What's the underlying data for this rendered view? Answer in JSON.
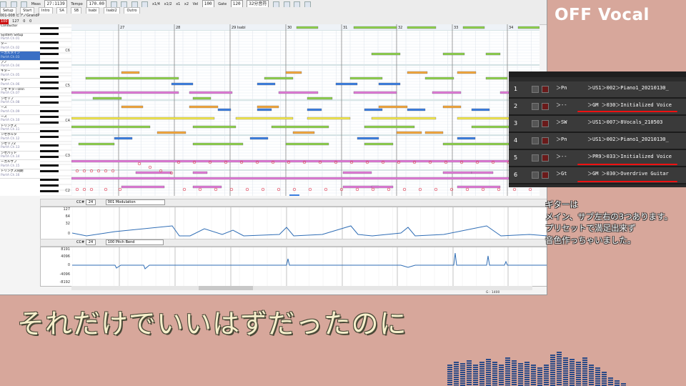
{
  "app": {
    "toolbar1": {
      "counter_label": "Meas",
      "counter_value": "27:1139",
      "tempo_label": "Tempo",
      "tempo_value": "170.00",
      "zoom_labels": [
        "x1/4",
        "x1/2",
        "x1",
        "x2"
      ],
      "vel_label": "Vel",
      "vel_value": "100",
      "gate_label": "Gate",
      "gate_value": "120",
      "snap_value": "32分音符"
    },
    "toolbar2": {
      "menu_items": [
        "Setup",
        "Start",
        "Intro",
        "SA",
        "SB",
        "Isabi",
        "Isabi2",
        "Outro"
      ]
    },
    "toolbar3": {
      "track_name": "001-008 ピアノGrandP",
      "values": [
        "100",
        "127",
        "0",
        "0"
      ]
    },
    "tracks": [
      {
        "name": "Conductor",
        "sub": ""
      },
      {
        "name": "System Setup",
        "sub": "PartA Ch.01"
      },
      {
        "name": "ター",
        "sub": "PartA Ch.02"
      },
      {
        "name": "ーカルメイン",
        "sub": "PartA Ch.03"
      },
      {
        "name": "アノ",
        "sub": "PartA Ch.04"
      },
      {
        "name": "ギター",
        "sub": "PartA Ch.05"
      },
      {
        "name": "ギター",
        "sub": "PartA Ch.06"
      },
      {
        "name": "ンセ ギターUnn",
        "sub": "PartA Ch.07"
      },
      {
        "name": "ンセリフ",
        "sub": "PartA Ch.08"
      },
      {
        "name": "ース",
        "sub": "PartA Ch.09"
      },
      {
        "name": "ース",
        "sub": "PartA Ch.10"
      },
      {
        "name": "トリングス",
        "sub": "PartA Ch.11"
      },
      {
        "name": "ンセボルタ",
        "sub": "PartA Ch.12"
      },
      {
        "name": "ンセリフ2",
        "sub": "PartA Ch.13"
      },
      {
        "name": "ンセパッド",
        "sub": "PartA Ch.14"
      },
      {
        "name": "ーカルサブ",
        "sub": "PartA Ch.15"
      },
      {
        "name": "トリングス同期",
        "sub": "PartA Ch.16"
      }
    ],
    "selected_track_index": 3,
    "measures": [
      "27",
      "28",
      "29 Isabi",
      "30",
      "31",
      "32",
      "33",
      "34"
    ],
    "octave_labels": [
      "C6",
      "C5",
      "C4",
      "C3",
      "C2"
    ],
    "controller1": {
      "cc": "CC#",
      "cc_num": "24",
      "type": "001 Modulation",
      "scale": [
        "127",
        "64",
        "32",
        "0"
      ]
    },
    "controller2": {
      "cc": "CC#",
      "cc_num": "24",
      "type": "100 Pitch Bend",
      "scale": [
        "8191",
        "4096",
        "0",
        "-4096",
        "-8192"
      ]
    },
    "status": "G : 1400"
  },
  "overlay": {
    "title": "OFF Vocal",
    "patches": [
      {
        "num": "1",
        "cat": "＞Pn",
        "name": "＞US1＞002＞Piano1_20210130_"
      },
      {
        "num": "2",
        "cat": "＞--",
        "name": "＞GM ＞030＞Initialized Voice"
      },
      {
        "num": "3",
        "cat": "＞SW",
        "name": "＞US1＞007＞8Vocals_210503"
      },
      {
        "num": "4",
        "cat": "＞Pn",
        "name": "＞US1＞002＞Piano1_20210130_"
      },
      {
        "num": "5",
        "cat": "＞--",
        "name": "＞PR9＞033＞Initialized Voice"
      },
      {
        "num": "6",
        "cat": "＞Gt",
        "name": "＞GM ＞030＞Overdrive Guitar"
      }
    ],
    "note_lines": [
      "ギターは",
      "メイン、サブ左右の3つあります。",
      "プリセットで満足出来ず",
      "音色作っちゃいました。"
    ],
    "lyric": "それだけでいいはずだったのに"
  },
  "colors": {
    "background": "#d7a79b",
    "selected_track": "#3a6fc4",
    "patch_panel": "#2b2b2b",
    "highlight": "#e11111",
    "lyric_text": "#f7f0cc",
    "equalizer": "#2b4a86"
  }
}
